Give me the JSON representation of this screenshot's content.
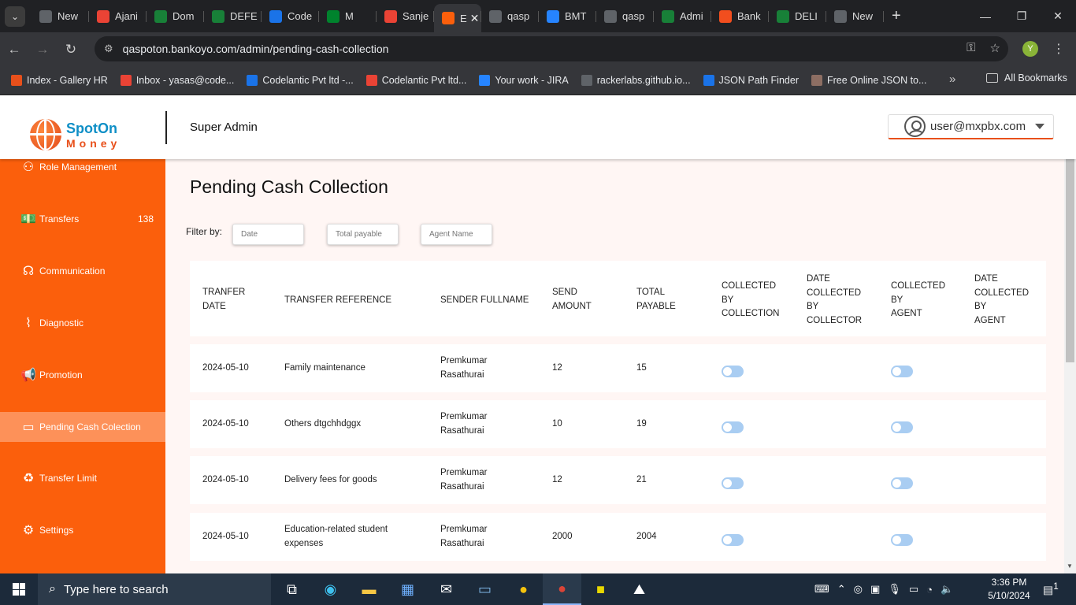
{
  "browser": {
    "tabs": [
      {
        "label": "New",
        "color": "#5f6368"
      },
      {
        "label": "Ajani",
        "color": "#ea4335"
      },
      {
        "label": "Dom",
        "color": "#188038"
      },
      {
        "label": "DEFE",
        "color": "#188038"
      },
      {
        "label": "Code",
        "color": "#1a73e8"
      },
      {
        "label": "M",
        "color": "#00832d"
      },
      {
        "label": "Sanje",
        "color": "#ea4335"
      },
      {
        "label": "E",
        "color": "#fb5f0c"
      },
      {
        "label": "qasp",
        "color": "#5f6368"
      },
      {
        "label": "BMT",
        "color": "#2684ff"
      },
      {
        "label": "qasp",
        "color": "#5f6368"
      },
      {
        "label": "Admi",
        "color": "#188038"
      },
      {
        "label": "Bank",
        "color": "#f24e1e"
      },
      {
        "label": "DELI",
        "color": "#188038"
      },
      {
        "label": "New",
        "color": "#5f6368"
      }
    ],
    "url": "qaspoton.bankoyo.com/admin/pending-cash-collection",
    "profile_initial": "Y",
    "bookmarks": [
      {
        "label": "Index - Gallery HR",
        "color": "#e8501b"
      },
      {
        "label": "Inbox - yasas@code...",
        "color": "#ea4335"
      },
      {
        "label": "Codelantic Pvt ltd -...",
        "color": "#1a73e8"
      },
      {
        "label": "Codelantic Pvt ltd...",
        "color": "#ea4335"
      },
      {
        "label": "Your work - JIRA",
        "color": "#2684ff"
      },
      {
        "label": "rackerlabs.github.io...",
        "color": "#5f6368"
      },
      {
        "label": "JSON Path Finder",
        "color": "#1a73e8"
      },
      {
        "label": "Free Online JSON to...",
        "color": "#8d6e63"
      }
    ],
    "all_bookmarks": "All Bookmarks"
  },
  "header": {
    "logo_top": "SpotOn",
    "logo_bottom": "Money",
    "title": "Super Admin",
    "user_email": "user@mxpbx.com"
  },
  "sidebar": {
    "items": [
      {
        "label": "Role Management",
        "icon": "users-icon",
        "count": ""
      },
      {
        "label": "Transfers",
        "icon": "money-icon",
        "count": "138"
      },
      {
        "label": "Communication",
        "icon": "headset-icon",
        "count": ""
      },
      {
        "label": "Diagnostic",
        "icon": "pulse-icon",
        "count": ""
      },
      {
        "label": "Promotion",
        "icon": "megaphone-icon",
        "count": ""
      },
      {
        "label": "Pending Cash Colection",
        "icon": "card-icon",
        "count": ""
      },
      {
        "label": "Transfer Limit",
        "icon": "recycle-icon",
        "count": ""
      },
      {
        "label": "Settings",
        "icon": "gear-icon",
        "count": ""
      }
    ]
  },
  "main": {
    "title": "Pending Cash Collection",
    "filter_label": "Filter by:",
    "filters": {
      "date_placeholder": "Date",
      "total_payable_placeholder": "Total payable",
      "agent_name_placeholder": "Agent Name"
    },
    "columns": [
      "TRANFER\nDATE",
      "TRANSFER REFERENCE",
      "SENDER FULLNAME",
      "SEND\nAMOUNT",
      "TOTAL\nPAYABLE",
      "COLLECTED\nBY\nCOLLECTION",
      "DATE\nCOLLECTED\nBY\nCOLLECTOR",
      "COLLECTED\nBY\nAGENT",
      "DATE\nCOLLECTED\nBY\nAGENT"
    ],
    "rows": [
      {
        "date": "2024-05-10",
        "reference": "Family maintenance",
        "sender": "Premkumar\nRasathurai",
        "send_amount": "12",
        "total_payable": "15",
        "collected_by_collection": false,
        "collected_by_agent": false
      },
      {
        "date": "2024-05-10",
        "reference": "Others dtgchhdggx",
        "sender": "Premkumar\nRasathurai",
        "send_amount": "10",
        "total_payable": "19",
        "collected_by_collection": false,
        "collected_by_agent": false
      },
      {
        "date": "2024-05-10",
        "reference": "Delivery fees for goods",
        "sender": "Premkumar\nRasathurai",
        "send_amount": "12",
        "total_payable": "21",
        "collected_by_collection": false,
        "collected_by_agent": false
      },
      {
        "date": "2024-05-10",
        "reference": "Education-related student\nexpenses",
        "sender": "Premkumar\nRasathurai",
        "send_amount": "2000",
        "total_payable": "2004",
        "collected_by_collection": false,
        "collected_by_agent": false
      }
    ]
  },
  "taskbar": {
    "search_placeholder": "Type here to search",
    "time": "3:36 PM",
    "date": "5/10/2024",
    "notifications": "1"
  }
}
